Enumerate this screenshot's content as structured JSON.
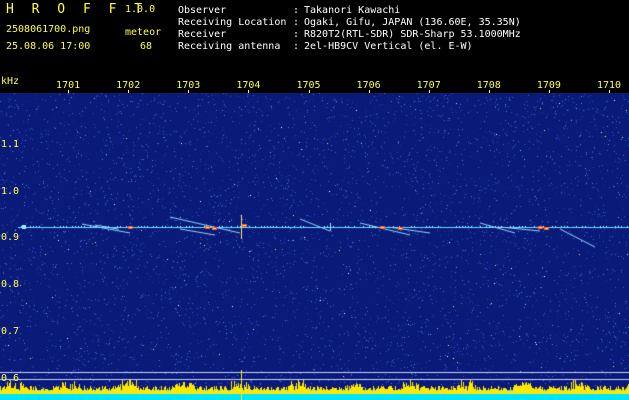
{
  "header": {
    "app_title": "H R O F F T",
    "app_version": "1.0.0",
    "filename": "2508061700.png",
    "datetime": "25.08.06 17:00",
    "meteor_label": "meteor",
    "meteor_count": "68",
    "info": [
      {
        "label": "Observer",
        "colon": ":",
        "value": "Takanori Kawachi"
      },
      {
        "label": "Receiving Location",
        "colon": ":",
        "value": "Ogaki, Gifu, JAPAN (136.60E, 35.35N)"
      },
      {
        "label": "Receiver",
        "colon": ":",
        "value": "R820T2(RTL-SDR) SDR-Sharp 53.1000MHz"
      },
      {
        "label": "Receiving antenna",
        "colon": ":",
        "value": "2el-HB9CV Vertical (el. E-W)"
      }
    ]
  },
  "axes": {
    "x_unit": "",
    "y_unit": "kHz",
    "x_ticks": [
      "1701",
      "1702",
      "1703",
      "1704",
      "1705",
      "1706",
      "1707",
      "1708",
      "1709",
      "1710"
    ],
    "y_ticks": [
      "1.1",
      "1.0",
      "0.9",
      "0.8",
      "0.7",
      "0.6"
    ]
  },
  "colors": {
    "label_yellow": "#ffff44",
    "background_blue": "#0a1a78",
    "carrier_cyan": "#66ddff",
    "echo_hot": "#ff5533"
  },
  "spectrogram": {
    "y_range_khz": [
      0.58,
      1.2
    ],
    "x_range_minutes": [
      1700,
      1710
    ],
    "carrier_khz": 0.925
  }
}
